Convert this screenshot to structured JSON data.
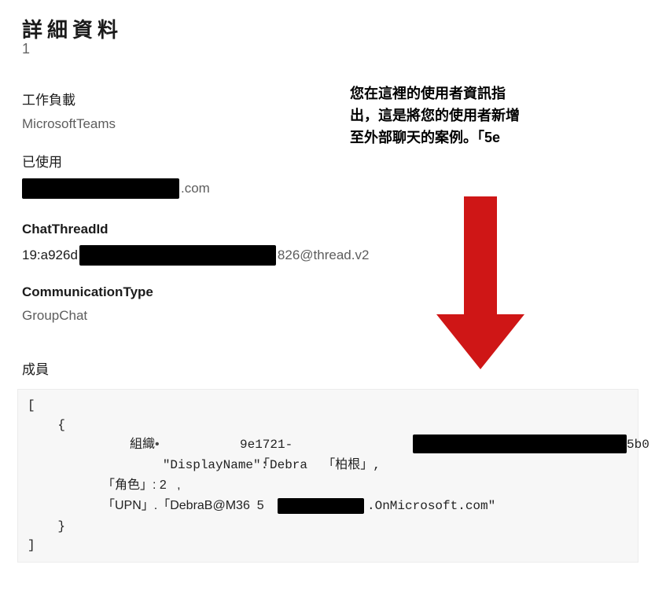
{
  "title": "詳細資料",
  "title_sub": "1",
  "annotation": "您在這裡的使用者資訊指出，這是將您的使用者新增至外部聊天的案例。「5e",
  "fields": {
    "workload": {
      "label": "工作負載",
      "value": "MicrosoftTeams"
    },
    "used": {
      "label": "已使用",
      "value_suffix": ".com"
    },
    "chatThreadId": {
      "label": "ChatThreadId",
      "prefix": "19:a926d",
      "suffix": "826@thread.v2"
    },
    "commType": {
      "label": "CommunicationType",
      "value": "GroupChat"
    },
    "members": {
      "label": "成員"
    }
  },
  "members_code": {
    "open_bracket": "[",
    "open_brace": "    {",
    "org_label": "組織",
    "org_mid_text": "9e1721-",
    "org_tail": "5b0",
    "display_name_key": "        \"DisplayName\": ",
    "display_name_cjk_open": "「",
    "display_name_val": "Debra  「柏根」,",
    "role_line": "「角色」: 2   ,",
    "upn_prefix": "「UPN」.「DebraB@M36  5",
    "upn_suffix": ".OnMicrosoft.com\"",
    "close_brace": "    }",
    "close_bracket": "]"
  },
  "colors": {
    "redaction": "#000000",
    "arrow": "#cf1616",
    "box_bg": "#f7f7f7"
  }
}
